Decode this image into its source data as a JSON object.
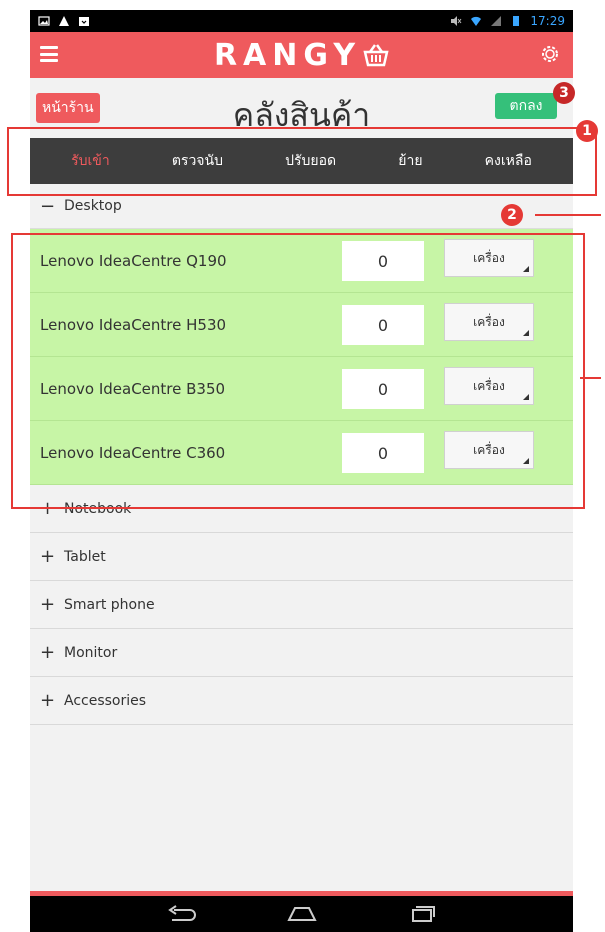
{
  "status_bar": {
    "time": "17:29"
  },
  "app_bar": {
    "brand": "RANGY",
    "menu_icon": "hamburger-icon",
    "settings_icon": "gear-icon",
    "brand_icon": "basket-icon"
  },
  "title_bar": {
    "shop_button": "หน้าร้าน",
    "title": "คลังสินค้า",
    "ok_button": "ตกลง"
  },
  "tabs": [
    {
      "label": "รับเข้า",
      "active": true
    },
    {
      "label": "ตรวจนับ",
      "active": false
    },
    {
      "label": "ปรับยอด",
      "active": false
    },
    {
      "label": "ย้าย",
      "active": false
    },
    {
      "label": "คงเหลือ",
      "active": false
    }
  ],
  "open_category": {
    "toggle": "−",
    "name": "Desktop"
  },
  "items": [
    {
      "name": "Lenovo IdeaCentre Q190",
      "qty": "0",
      "unit": "เครื่อง"
    },
    {
      "name": "Lenovo IdeaCentre H530",
      "qty": "0",
      "unit": "เครื่อง"
    },
    {
      "name": "Lenovo IdeaCentre B350",
      "qty": "0",
      "unit": "เครื่อง"
    },
    {
      "name": "Lenovo IdeaCentre C360",
      "qty": "0",
      "unit": "เครื่อง"
    }
  ],
  "closed_categories": [
    {
      "toggle": "+",
      "name": "Notebook"
    },
    {
      "toggle": "+",
      "name": "Tablet"
    },
    {
      "toggle": "+",
      "name": "Smart phone"
    },
    {
      "toggle": "+",
      "name": "Monitor"
    },
    {
      "toggle": "+",
      "name": "Accessories"
    }
  ],
  "annotations": {
    "badge_1": "1",
    "badge_2": "2",
    "badge_3": "3"
  },
  "colors": {
    "accent": "#ef5a5d",
    "ok": "#35c07a",
    "tabs_bg": "#3d3d3d",
    "item_bg": "#c7f5a6",
    "annotation": "#e53935"
  }
}
